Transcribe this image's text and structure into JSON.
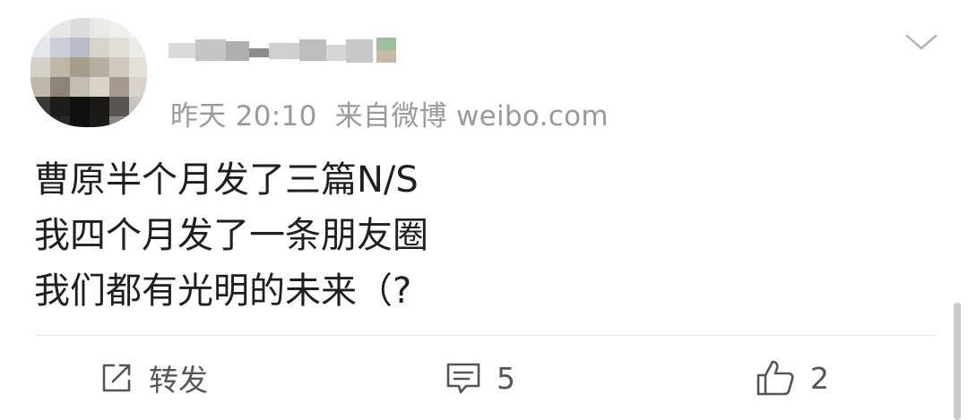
{
  "post": {
    "meta": {
      "time": "昨天 20:10",
      "source": "来自微博 weibo.com"
    },
    "content_lines": [
      "曹原半个月发了三篇N/S",
      "我四个月发了一条朋友圈",
      "我们都有光明的未来（?"
    ],
    "actions": {
      "repost": {
        "label": "转发",
        "icon": "share-icon"
      },
      "comment": {
        "count": "5",
        "icon": "comment-icon"
      },
      "like": {
        "count": "2",
        "icon": "thumbs-up-icon"
      }
    },
    "menu_icon": "chevron-down-icon"
  },
  "colors": {
    "text_primary": "#1f1f1f",
    "text_meta": "#9a9a9a",
    "action_text": "#555555",
    "divider": "#ececec",
    "scrollbar": "#c9c9c9"
  }
}
